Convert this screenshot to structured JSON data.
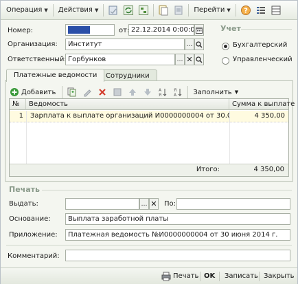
{
  "toolbar": {
    "operation_label": "Операция",
    "actions_label": "Действия",
    "goto_label": "Перейти"
  },
  "header": {
    "number_label": "Номер:",
    "number_value": "",
    "date_label": "от:",
    "date_value": "22.12.2014  0:00:00",
    "org_label": "Организация:",
    "org_value": "Институт",
    "resp_label": "Ответственный:",
    "resp_value": "Горбунков"
  },
  "accounting": {
    "title": "Учет",
    "options": [
      "Бухгалтерский",
      "Управленческий"
    ],
    "selected": 0
  },
  "tabs": [
    {
      "label": "Платежные ведомости",
      "active": true
    },
    {
      "label": "Сотрудники",
      "active": false
    }
  ],
  "table_toolbar": {
    "add_label": "Добавить",
    "fill_label": "Заполнить"
  },
  "table": {
    "columns": [
      "№",
      "Ведомость",
      "Сумма к выплате"
    ],
    "rows": [
      {
        "n": "1",
        "statement": "Зарплата к выплате организаций И0000000004 от 30.0...",
        "amount": "4 350,00"
      }
    ],
    "total_label": "Итого:",
    "total_value": "4 350,00"
  },
  "print": {
    "title": "Печать",
    "issue_label": "Выдать:",
    "issue_value": "",
    "to_label": "По:",
    "to_value": "",
    "basis_label": "Основание:",
    "basis_value": "Выплата заработной платы",
    "attach_label": "Приложение:",
    "attach_value": "Платежная ведомость  №И0000000004 от 30 июня 2014 г."
  },
  "comment": {
    "label": "Комментарий:",
    "value": ""
  },
  "footer": {
    "print_label": "Печать",
    "ok_label": "OK",
    "save_label": "Записать",
    "close_label": "Закрыть"
  },
  "colors": {
    "number_highlight": "#2b4fa8",
    "delete_red": "#d23a2a",
    "add_green": "#3a9a3a"
  }
}
